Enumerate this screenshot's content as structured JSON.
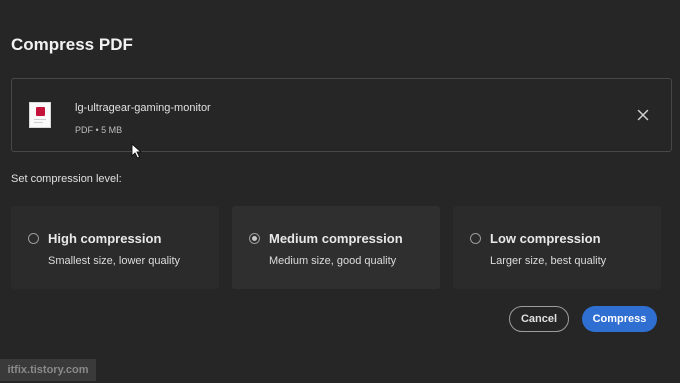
{
  "dialog": {
    "title": "Compress PDF",
    "compression_label": "Set compression level:"
  },
  "file": {
    "name": "lg-ultragear-gaming-monitor",
    "meta": "PDF • 5 MB",
    "close_icon": "close-icon"
  },
  "options": [
    {
      "title": "High compression",
      "subtitle": "Smallest size, lower quality",
      "selected": false
    },
    {
      "title": "Medium compression",
      "subtitle": "Medium size, good quality",
      "selected": true
    },
    {
      "title": "Low compression",
      "subtitle": "Larger size, best quality",
      "selected": false
    }
  ],
  "buttons": {
    "cancel": "Cancel",
    "compress": "Compress"
  },
  "colors": {
    "background": "#262626",
    "primary": "#2e6fd1",
    "thumbnail_accent": "#c4123b"
  },
  "watermark": "itfix.tistory.com"
}
